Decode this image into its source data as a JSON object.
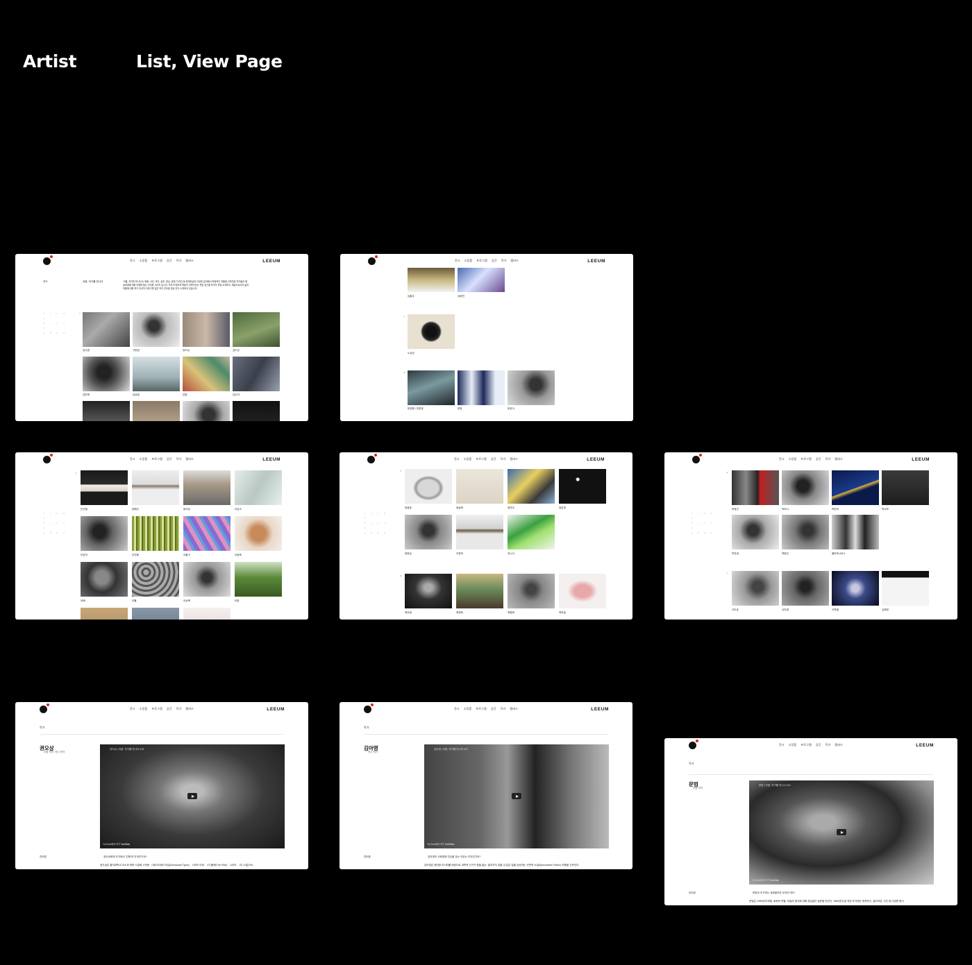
{
  "heading": {
    "left": "Artist",
    "right": "List, View Page"
  },
  "site": {
    "brand": "LEEUM",
    "menu": [
      "전시",
      "소장품",
      "프로그램",
      "공간",
      "작가",
      "멤버스"
    ]
  },
  "list1": {
    "crumb": "작가",
    "intro_title": "리움, 작가를 만나다",
    "intro_lines": [
      "‘리움, 작가를 만나다’는 회화, 사진, 조각, 설치, 영상, 공예, 디자인 등 현대미술의 다양한 분야에서 독창적인 작품을 선보여온 작가들의 예",
      "술세계에 대한 이해를 돕는 인터뷰 시리즈 입니다. 작가의 창조적 활동이 이루어지는 작업 공간을 작가가 직접 소개하고, 예술가로서의 삶과",
      "작품에 대한 작가 자신의 이야기를 담은 작가 인터뷰 영상 칸이 소개되어 있습니다."
    ],
    "index": [
      "ㄱ ㄴ ㄷ ㄹ ㅁ",
      "ㅂ ㅅ ㅇ ㅈ ㅊ",
      "ㅋ ㅌ ㅍ ㅎ"
    ],
    "section": "ㄱ",
    "names": [
      "강서경",
      "구본창",
      "권오상",
      "김도균",
      "김민애",
      "김상일",
      "김범",
      "김수자"
    ]
  },
  "list2": {
    "names_top": [
      "김홍주",
      "김희천"
    ],
    "section_n": "ㄴ",
    "names_n": [
      "노상균"
    ],
    "section_m": "ㅁ",
    "names_m": [
      "문경원 / 전준호",
      "문범",
      "문성식"
    ]
  },
  "list3": {
    "section": "ㅇ",
    "names": [
      "안규철",
      "양혜규",
      "윤석남",
      "이강소",
      "이강직",
      "이건용",
      "이불기",
      "이동욱",
      "이배",
      "이불",
      "이승택",
      "이완"
    ]
  },
  "list4": {
    "section_j": "ㅈ",
    "names_j": [
      "정광호",
      "정상화",
      "정연두",
      "정은영",
      "정희승",
      "주명덕",
      "지니서"
    ],
    "section_c": "ㅊ",
    "names_c": [
      "최우람",
      "최정화",
      "최종태",
      "최하늘"
    ]
  },
  "list5": {
    "section_b": "ㅂ",
    "names_b": [
      "박경근",
      "박미나",
      "박민하",
      "박서보",
      "박찬경",
      "백현진",
      "플라토니아스"
    ],
    "section_s": "ㅅ",
    "names_s": [
      "서도호",
      "신미경",
      "신학철",
      "심래정"
    ]
  },
  "detail1": {
    "crumb": "작가",
    "name": "권오상",
    "subtitle": "소장 작가, 전시 작가",
    "video_title": "권오상 | 리움, 작가를 만나다 #18",
    "watch": "YouTube에서 보기",
    "yt": "YouTube",
    "interview_label": "인터뷰",
    "question": "권오상에게 조각에서 ‘진짜’란 무엇인가요?",
    "answer": "권오상은 홍익대학교 조소과 재학 시절에 시작한 〈데오도란트 타입(Deodorant Type)〉 시리즈 이후, 〈더 플랫(The Flat)〉 시리즈, 〈더 스컬(The"
  },
  "detail2": {
    "crumb": "작가",
    "name": "김아영",
    "subtitle": "전시 작가",
    "video_title": "김아영 | 리움, 작가를 만나다 #47",
    "watch": "YouTube에서 보기",
    "yt": "YouTube",
    "interview_label": "인터뷰",
    "question": "김아영이 사회경제 관심을 갖는 이유는 무엇인가요?",
    "answer": "김아영은 현대한 리서치를 바탕으로 과학적 근거가 힘을 잃는, 탈리지지 않을 것 같은 일을 상상하는 사변적 소설(Speculative Fiction) 작품을 선보인다."
  },
  "detail3": {
    "crumb": "작가",
    "name": "문범",
    "subtitle": "소장 작가",
    "video_title": "문범 | 리움, 작가를 만나다 #31",
    "watch": "YouTube에서 보기",
    "yt": "YouTube",
    "interview_label": "인터뷰",
    "question": "문범이 추구하는 새로움이란 무엇인가요?",
    "answer": "문범은 1980년대 래핑, 회화의 역할, 미술의 형식에 대해 끊임없이 질문을 던진다. 1980년대 말 작업 초기에는 퍼포먼스, 설치작업, 사진 등 다양한 형식"
  }
}
